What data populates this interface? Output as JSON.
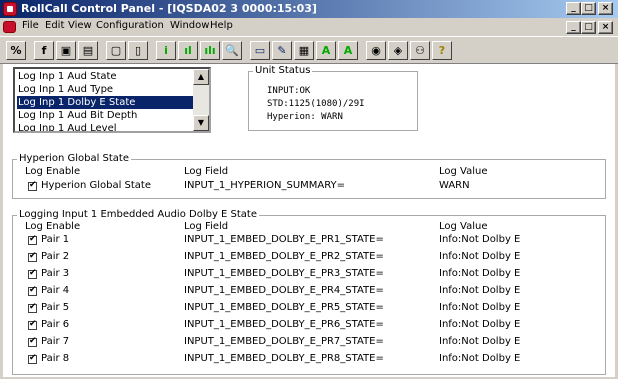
{
  "window": {
    "title": "RollCall Control Panel - [IQSDA02 3 0000:15:03]",
    "min": "_",
    "max": "□",
    "close": "×"
  },
  "menu": {
    "items": [
      "File",
      "Edit",
      "View",
      "Configuration",
      "Window",
      "Help"
    ],
    "doc_min": "_",
    "doc_max": "□",
    "doc_close": "×"
  },
  "toolbar": {
    "glyphs": [
      "%",
      "f",
      "▣",
      "▤",
      "▢",
      "▯",
      "i",
      "ıl",
      "ılı",
      "🔍",
      "▭",
      "✎",
      "▦",
      "A",
      "A",
      "◉",
      "◈",
      "⚇",
      "?"
    ]
  },
  "param_list": {
    "items": [
      "Log Inp 1 Aud State",
      "Log Inp 1 Aud Type",
      "Log Inp 1 Dolby E State",
      "Log Inp 1 Aud Bit Depth",
      "Log Inp 1 Aud Level"
    ],
    "selected_index": 2,
    "up_arrow": "▲",
    "down_arrow": "▼"
  },
  "unit_status": {
    "legend": "Unit Status",
    "lines": [
      "INPUT:OK",
      "STD:1125(1080)/29I",
      "Hyperion: WARN"
    ]
  },
  "hyperion": {
    "legend": "Hyperion Global State",
    "col_enable": "Log Enable",
    "col_field": "Log Field",
    "col_value": "Log Value",
    "row": {
      "enable_label": "Hyperion Global State",
      "field": "INPUT_1_HYPERION_SUMMARY=",
      "value": "WARN",
      "checked": true
    }
  },
  "dolby": {
    "legend": "Logging Input 1 Embedded Audio Dolby E State",
    "col_enable": "Log Enable",
    "col_field": "Log Field",
    "col_value": "Log Value",
    "rows": [
      {
        "label": "Pair 1",
        "field": "INPUT_1_EMBED_DOLBY_E_PR1_STATE=",
        "value": "Info:Not Dolby E",
        "checked": true
      },
      {
        "label": "Pair 2",
        "field": "INPUT_1_EMBED_DOLBY_E_PR2_STATE=",
        "value": "Info:Not Dolby E",
        "checked": true
      },
      {
        "label": "Pair 3",
        "field": "INPUT_1_EMBED_DOLBY_E_PR3_STATE=",
        "value": "Info:Not Dolby E",
        "checked": true
      },
      {
        "label": "Pair 4",
        "field": "INPUT_1_EMBED_DOLBY_E_PR4_STATE=",
        "value": "Info:Not Dolby E",
        "checked": true
      },
      {
        "label": "Pair 5",
        "field": "INPUT_1_EMBED_DOLBY_E_PR5_STATE=",
        "value": "Info:Not Dolby E",
        "checked": true
      },
      {
        "label": "Pair 6",
        "field": "INPUT_1_EMBED_DOLBY_E_PR6_STATE=",
        "value": "Info:Not Dolby E",
        "checked": true
      },
      {
        "label": "Pair 7",
        "field": "INPUT_1_EMBED_DOLBY_E_PR7_STATE=",
        "value": "Info:Not Dolby E",
        "checked": true
      },
      {
        "label": "Pair 8",
        "field": "INPUT_1_EMBED_DOLBY_E_PR8_STATE=",
        "value": "Info:Not Dolby E",
        "checked": true
      }
    ]
  }
}
